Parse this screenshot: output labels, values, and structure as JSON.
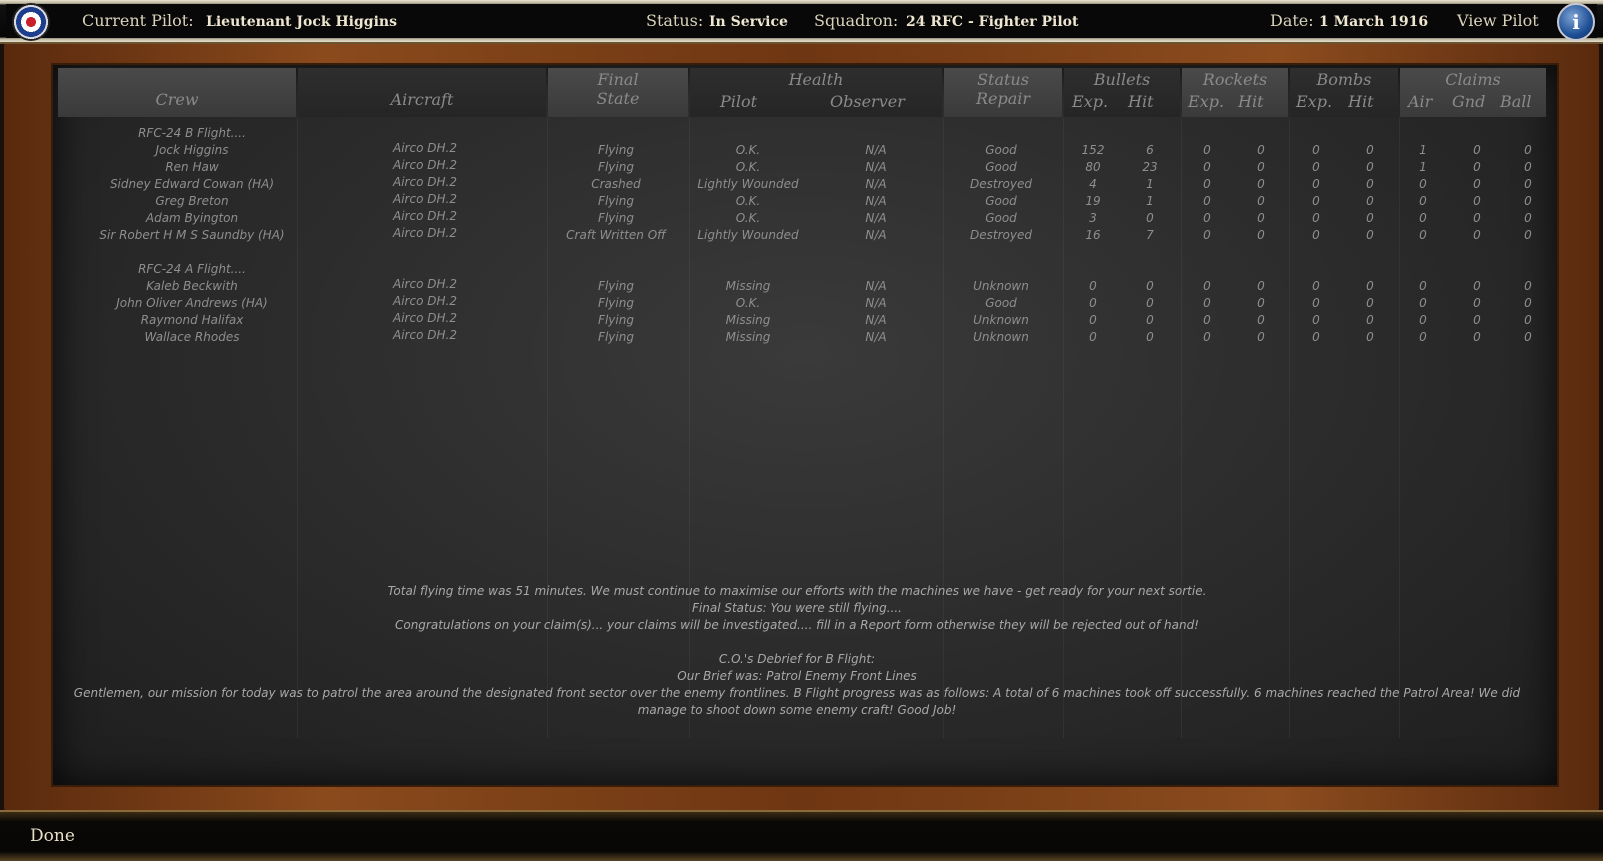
{
  "topbar": {
    "current_pilot_label": "Current Pilot:",
    "current_pilot_value": "Lieutenant Jock Higgins",
    "status_label": "Status:",
    "status_value": "In Service",
    "squadron_label": "Squadron:",
    "squadron_value": "24 RFC - Fighter Pilot",
    "date_label": "Date:",
    "date_value": "1 March 1916",
    "view_pilot_label": "View Pilot",
    "info_icon": "i"
  },
  "headers": {
    "crew": "Crew",
    "aircraft": "Aircraft",
    "final_state_1": "Final",
    "final_state_2": "State",
    "health": "Health",
    "pilot": "Pilot",
    "observer": "Observer",
    "status_1": "Status",
    "status_2": "Repair",
    "bullets": "Bullets",
    "rockets": "Rockets",
    "bombs": "Bombs",
    "claims": "Claims",
    "exp": "Exp.",
    "hit": "Hit",
    "air": "Air",
    "gnd": "Gnd",
    "ball": "Ball"
  },
  "groups": [
    {
      "name": "RFC-24 B Flight....",
      "rows": [
        {
          "crew": "Jock Higgins",
          "aircraft": "Airco DH.2",
          "state": "Flying",
          "pilot": "O.K.",
          "observer": "N/A",
          "repair": "Good",
          "b_exp": "152",
          "b_hit": "6",
          "r_exp": "0",
          "r_hit": "0",
          "bo_exp": "0",
          "bo_hit": "0",
          "air": "1",
          "gnd": "0",
          "ball": "0"
        },
        {
          "crew": "Ren Haw",
          "aircraft": "Airco DH.2",
          "state": "Flying",
          "pilot": "O.K.",
          "observer": "N/A",
          "repair": "Good",
          "b_exp": "80",
          "b_hit": "23",
          "r_exp": "0",
          "r_hit": "0",
          "bo_exp": "0",
          "bo_hit": "0",
          "air": "1",
          "gnd": "0",
          "ball": "0"
        },
        {
          "crew": "Sidney Edward Cowan (HA)",
          "aircraft": "Airco DH.2",
          "state": "Crashed",
          "pilot": "Lightly Wounded",
          "observer": "N/A",
          "repair": "Destroyed",
          "b_exp": "4",
          "b_hit": "1",
          "r_exp": "0",
          "r_hit": "0",
          "bo_exp": "0",
          "bo_hit": "0",
          "air": "0",
          "gnd": "0",
          "ball": "0"
        },
        {
          "crew": "Greg Breton",
          "aircraft": "Airco DH.2",
          "state": "Flying",
          "pilot": "O.K.",
          "observer": "N/A",
          "repair": "Good",
          "b_exp": "19",
          "b_hit": "1",
          "r_exp": "0",
          "r_hit": "0",
          "bo_exp": "0",
          "bo_hit": "0",
          "air": "0",
          "gnd": "0",
          "ball": "0"
        },
        {
          "crew": "Adam Byington",
          "aircraft": "Airco DH.2",
          "state": "Flying",
          "pilot": "O.K.",
          "observer": "N/A",
          "repair": "Good",
          "b_exp": "3",
          "b_hit": "0",
          "r_exp": "0",
          "r_hit": "0",
          "bo_exp": "0",
          "bo_hit": "0",
          "air": "0",
          "gnd": "0",
          "ball": "0"
        },
        {
          "crew": "Sir Robert H M S Saundby (HA)",
          "aircraft": "Airco DH.2",
          "state": "Craft Written Off",
          "pilot": "Lightly Wounded",
          "observer": "N/A",
          "repair": "Destroyed",
          "b_exp": "16",
          "b_hit": "7",
          "r_exp": "0",
          "r_hit": "0",
          "bo_exp": "0",
          "bo_hit": "0",
          "air": "0",
          "gnd": "0",
          "ball": "0"
        }
      ]
    },
    {
      "name": "RFC-24 A Flight....",
      "rows": [
        {
          "crew": "Kaleb Beckwith",
          "aircraft": "Airco DH.2",
          "state": "Flying",
          "pilot": "Missing",
          "observer": "N/A",
          "repair": "Unknown",
          "b_exp": "0",
          "b_hit": "0",
          "r_exp": "0",
          "r_hit": "0",
          "bo_exp": "0",
          "bo_hit": "0",
          "air": "0",
          "gnd": "0",
          "ball": "0"
        },
        {
          "crew": "John Oliver Andrews (HA)",
          "aircraft": "Airco DH.2",
          "state": "Flying",
          "pilot": "O.K.",
          "observer": "N/A",
          "repair": "Good",
          "b_exp": "0",
          "b_hit": "0",
          "r_exp": "0",
          "r_hit": "0",
          "bo_exp": "0",
          "bo_hit": "0",
          "air": "0",
          "gnd": "0",
          "ball": "0"
        },
        {
          "crew": "Raymond Halifax",
          "aircraft": "Airco DH.2",
          "state": "Flying",
          "pilot": "Missing",
          "observer": "N/A",
          "repair": "Unknown",
          "b_exp": "0",
          "b_hit": "0",
          "r_exp": "0",
          "r_hit": "0",
          "bo_exp": "0",
          "bo_hit": "0",
          "air": "0",
          "gnd": "0",
          "ball": "0"
        },
        {
          "crew": "Wallace Rhodes",
          "aircraft": "Airco DH.2",
          "state": "Flying",
          "pilot": "Missing",
          "observer": "N/A",
          "repair": "Unknown",
          "b_exp": "0",
          "b_hit": "0",
          "r_exp": "0",
          "r_hit": "0",
          "bo_exp": "0",
          "bo_hit": "0",
          "air": "0",
          "gnd": "0",
          "ball": "0"
        }
      ]
    }
  ],
  "debrief": [
    "Total flying time was 51 minutes.  We must continue to maximise our efforts with the machines we have - get ready for your next sortie.",
    "Final Status: You were still flying....",
    "Congratulations on your claim(s)... your claims will be investigated.... fill in a Report form otherwise they will be rejected out of hand!",
    "",
    "C.O.'s Debrief for B Flight:",
    "Our Brief was: Patrol Enemy Front Lines",
    "Gentlemen, our mission for today was to patrol the area around the designated front sector over the enemy frontlines. B Flight progress was as follows: A total of 6 machines took off successfully. 6 machines reached the Patrol Area! We did manage to shoot down some enemy craft! Good Job!"
  ],
  "bottombar": {
    "done_label": "Done"
  }
}
